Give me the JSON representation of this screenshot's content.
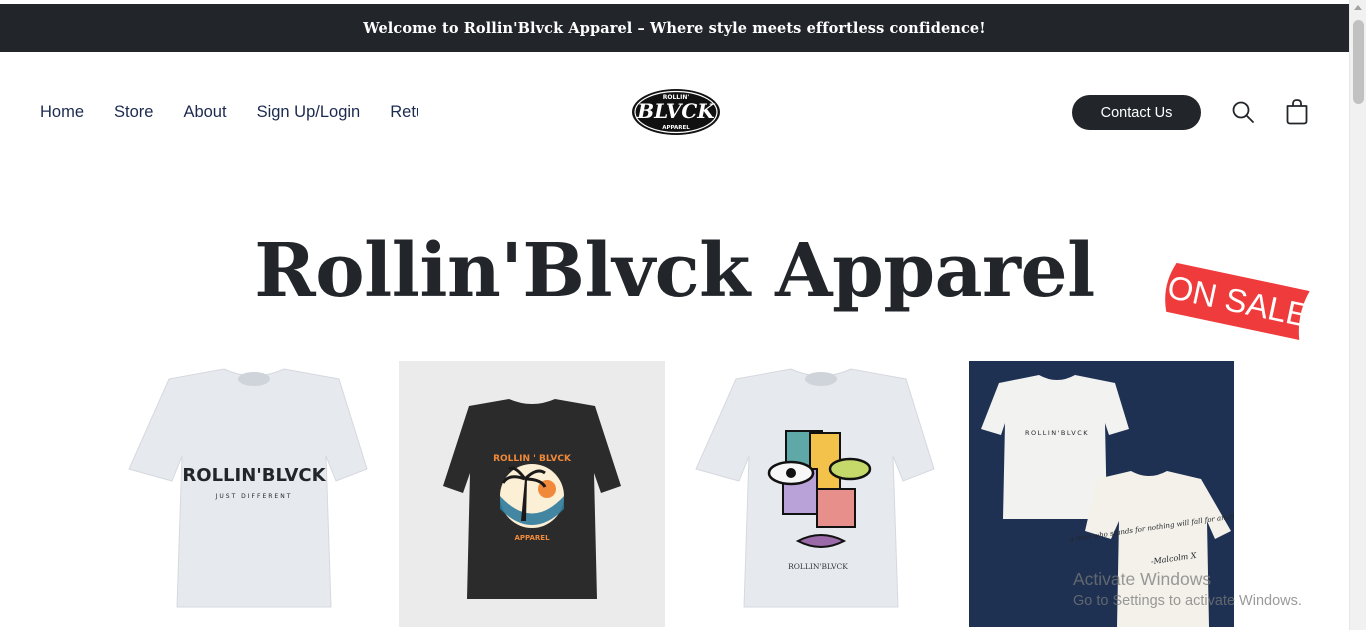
{
  "announcement": "Welcome to Rollin'Blvck Apparel – Where style meets effortless confidence!",
  "nav": {
    "items": [
      "Home",
      "Store",
      "About",
      "Sign Up/Login",
      "Return"
    ]
  },
  "logo": {
    "top_text": "ROLLIN'",
    "main_text": "BLVCK",
    "bottom_text": "APPAREL"
  },
  "header": {
    "contact_label": "Contact Us",
    "search_icon": "search-icon",
    "cart_icon": "shopping-bag-icon"
  },
  "hero": {
    "title": "Rollin'Blvck Apparel",
    "sale_badge": "ON SALE",
    "sale_color": "#ef3b3b"
  },
  "products": [
    {
      "print_main": "ROLLIN'BLVCK",
      "print_sub": "JUST DIFFERENT",
      "shirt_color": "#e6e9ee"
    },
    {
      "print_top": "ROLLIN ' BLVCK",
      "print_bottom": "APPAREL",
      "shirt_color": "#2b2b2b",
      "accent": "#f08a3a"
    },
    {
      "print_main": "ROLLIN'BLVCK",
      "shirt_color": "#e6e9ee"
    },
    {
      "print_main": "ROLLIN'BLVCK",
      "quote": "a man who stands for nothing will fall for anything",
      "quote_sig": "-Malcolm X",
      "background": "#1f3152"
    }
  ],
  "windows_watermark": {
    "line1": "Activate Windows",
    "line2": "Go to Settings to activate Windows."
  }
}
